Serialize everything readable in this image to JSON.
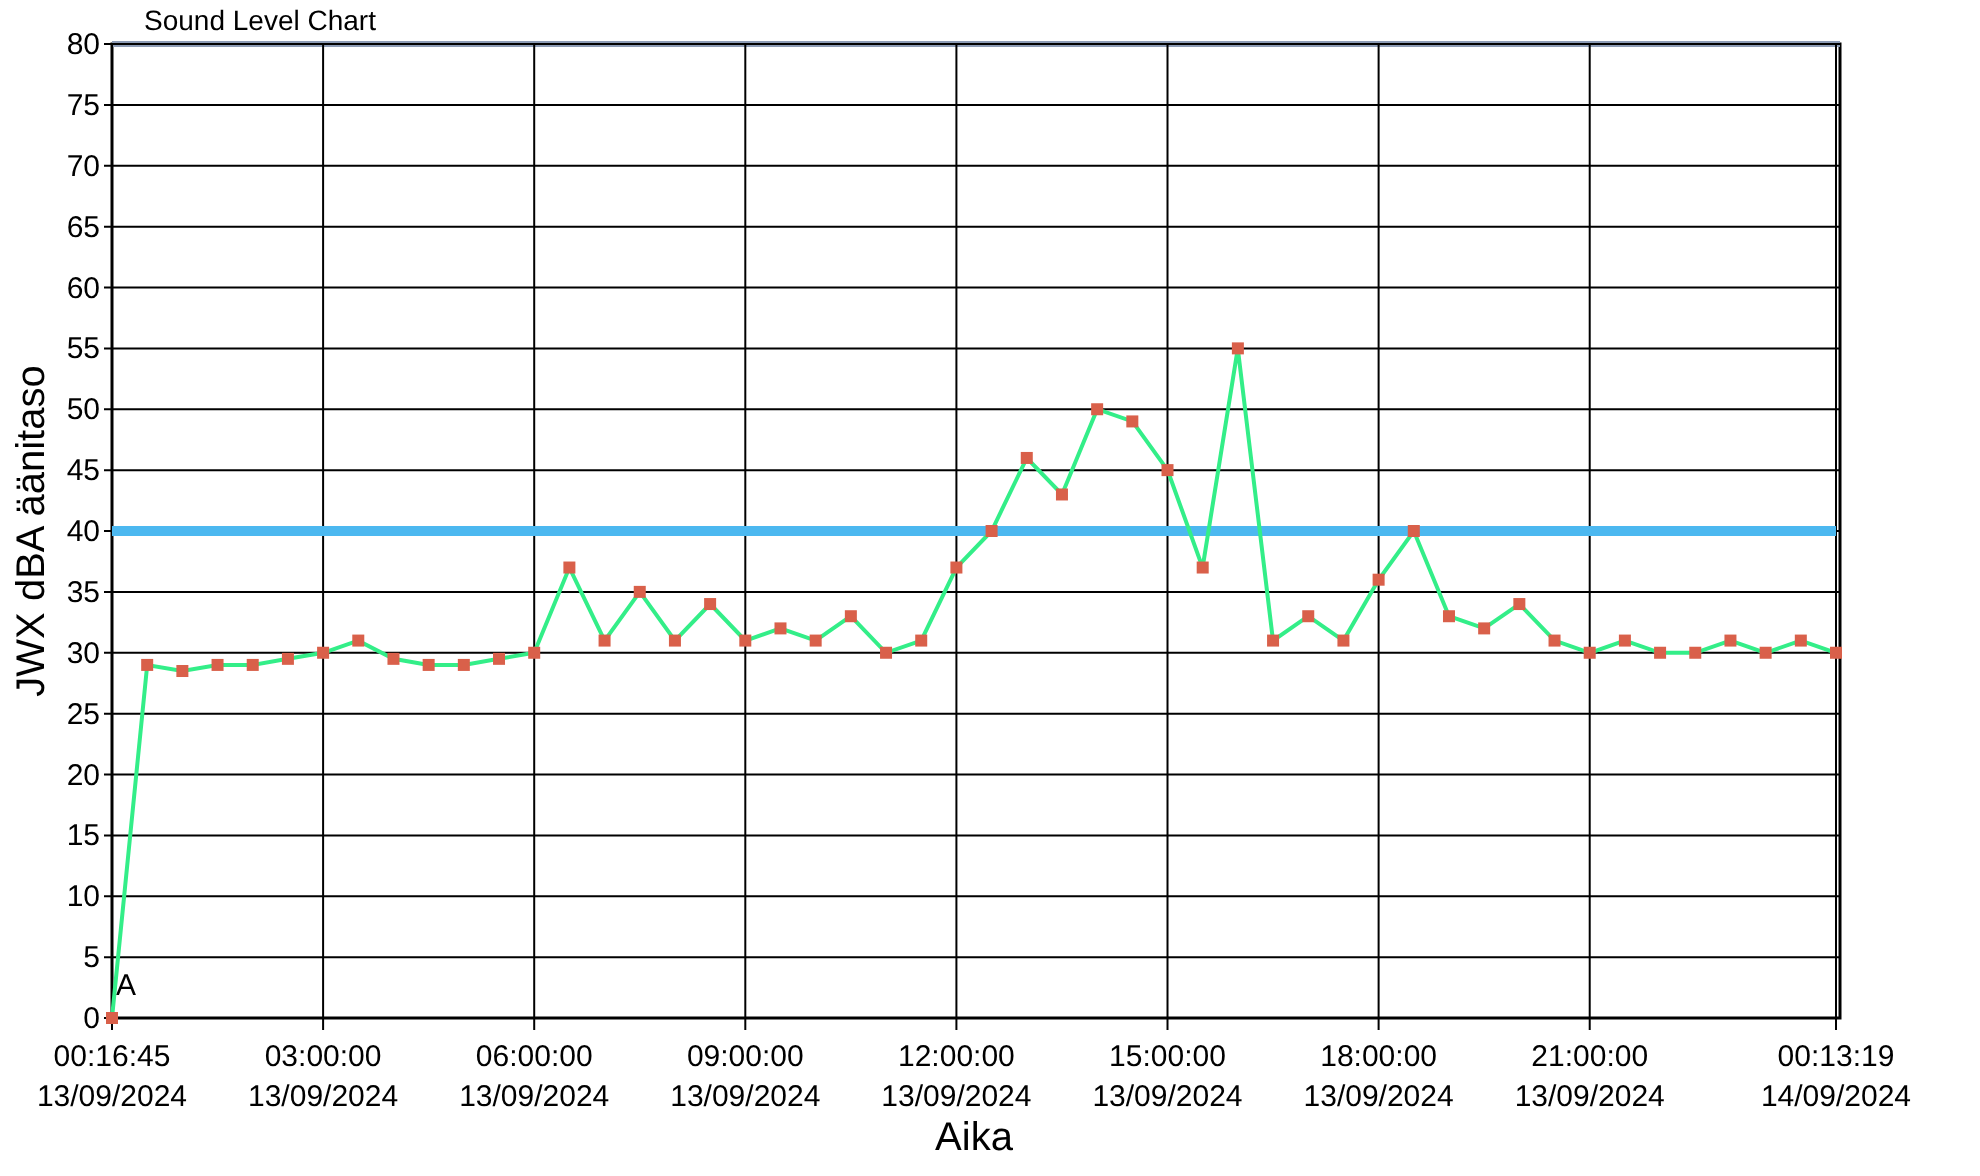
{
  "chart": {
    "chart_data": {
      "type": "line",
      "title": "Sound Level Chart",
      "xlabel": "Aika",
      "ylabel": "JWX dBA äänitaso",
      "categories": [
        "00:16:45\n13/09/2024",
        null,
        null,
        null,
        null,
        null,
        "03:00:00\n13/09/2024",
        null,
        null,
        null,
        null,
        null,
        "06:00:00\n13/09/2024",
        null,
        null,
        null,
        null,
        null,
        "09:00:00\n13/09/2024",
        null,
        null,
        null,
        null,
        null,
        "12:00:00\n13/09/2024",
        null,
        null,
        null,
        null,
        null,
        "15:00:00\n13/09/2024",
        null,
        null,
        null,
        null,
        null,
        "18:00:00\n13/09/2024",
        null,
        null,
        null,
        null,
        null,
        "21:00:00\n13/09/2024",
        null,
        null,
        null,
        null,
        null,
        null,
        "00:13:19\n14/09/2024"
      ],
      "grid": true,
      "series": [
        {
          "color": "#4cb8f0",
          "values": [
            40,
            40,
            40,
            40,
            40,
            40,
            40,
            40,
            40,
            40,
            40,
            40,
            40,
            40,
            40,
            40,
            40,
            40,
            40,
            40,
            40,
            40,
            40,
            40,
            40,
            40,
            40,
            40,
            40,
            40,
            40,
            40,
            40,
            40,
            40,
            40,
            40,
            40,
            40,
            40,
            40,
            40,
            40,
            40,
            40,
            40,
            40,
            40,
            40,
            40
          ]
        },
        {
          "color": "#33ee88",
          "marker": "square",
          "values": [
            0,
            29,
            28.5,
            29,
            29,
            29.5,
            30,
            31,
            29.5,
            29,
            29,
            29.5,
            30,
            37,
            31,
            35,
            31,
            34,
            31,
            32,
            31,
            33,
            30,
            31,
            37,
            40,
            46,
            43,
            50,
            49,
            45,
            37,
            55,
            31,
            33,
            31,
            36,
            40,
            33,
            32,
            34,
            31,
            30,
            31,
            30,
            30,
            31,
            30,
            31,
            30
          ]
        }
      ],
      "ylim": [
        0,
        80
      ],
      "yticks": [
        0,
        5,
        10,
        15,
        20,
        25,
        30,
        35,
        40,
        45,
        50,
        55,
        60,
        65,
        70,
        75,
        80
      ],
      "annotations": [
        {
          "x": "00:16:45\n13/09/2024",
          "y": 4,
          "text": "A"
        }
      ]
    }
  }
}
